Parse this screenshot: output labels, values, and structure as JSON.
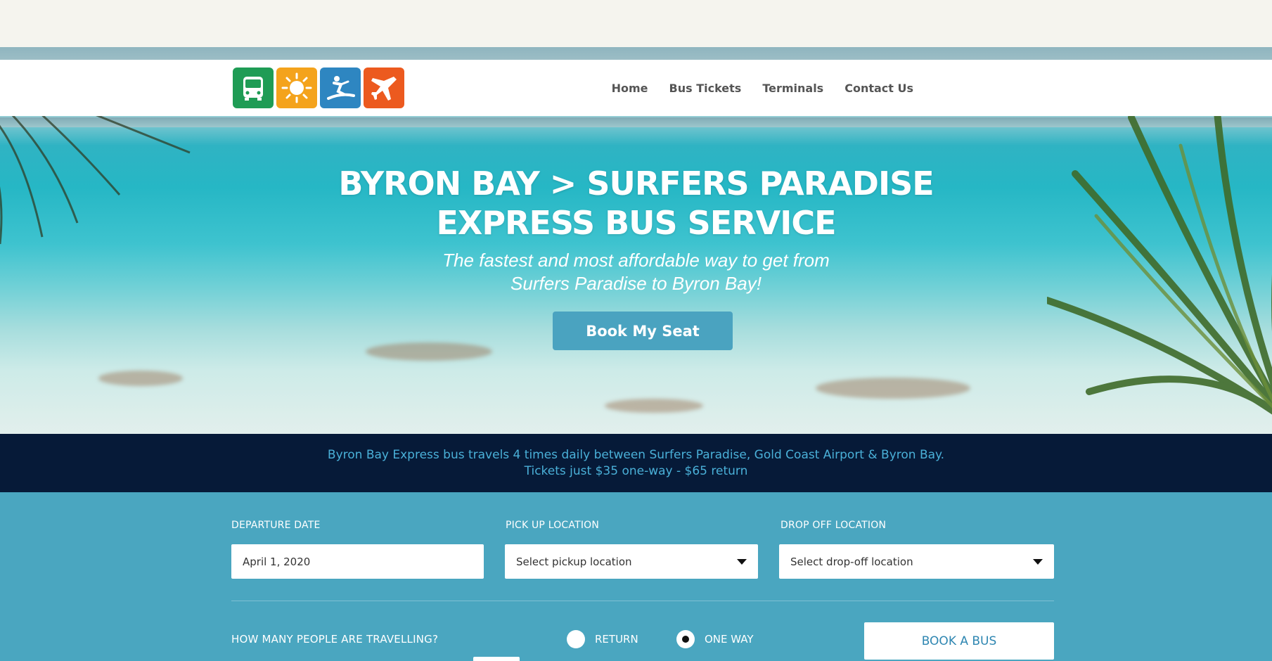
{
  "nav": {
    "items": [
      "Home",
      "Bus Tickets",
      "Terminals",
      "Contact Us"
    ]
  },
  "logo": {
    "tiles": [
      "bus-icon",
      "sun-icon",
      "surfer-icon",
      "airplane-icon"
    ],
    "colors": [
      "#1f9c55",
      "#f4a31c",
      "#2e86c1",
      "#ec5a1f"
    ]
  },
  "hero": {
    "headline_line1": "BYRON BAY > SURFERS PARADISE",
    "headline_line2": "EXPRESS BUS SERVICE",
    "subline_line1": "The fastest and most affordable way to get from",
    "subline_line2": "Surfers Paradise to Byron Bay!",
    "cta_label": "Book My Seat"
  },
  "info": {
    "line1": "Byron Bay Express bus travels 4 times daily between Surfers Paradise, Gold Coast Airport & Byron Bay.",
    "line2": "Tickets just $35 one-way - $65 return"
  },
  "form": {
    "departure_label": "DEPARTURE DATE",
    "departure_value": "April 1, 2020",
    "pickup_label": "PICK UP LOCATION",
    "pickup_placeholder": "Select pickup location",
    "dropoff_label": "DROP OFF LOCATION",
    "dropoff_placeholder": "Select drop-off location",
    "people_label": "HOW MANY PEOPLE ARE TRAVELLING?",
    "return_label": "RETURN",
    "oneway_label": "ONE WAY",
    "selected_trip": "ONE WAY",
    "book_label": "BOOK A BUS"
  },
  "colors": {
    "brand_blue": "#4aa6c0",
    "info_bar": "#061a38",
    "info_text": "#4ab0d8"
  }
}
